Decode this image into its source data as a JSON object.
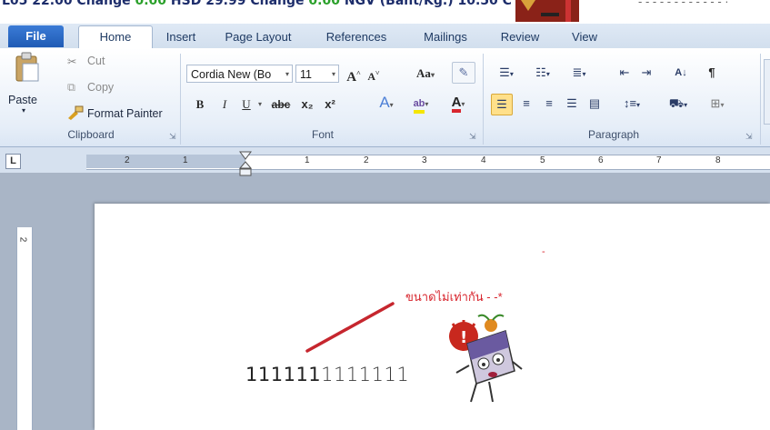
{
  "ticker": {
    "text1": "L05 22.00 Change ",
    "g1": "0.00",
    "text2": " HSD 29.99 Change ",
    "g2": "0.00",
    "text3": " NGV (Baht/Kg.) 10.50 C"
  },
  "tabs": [
    "File",
    "Home",
    "Insert",
    "Page Layout",
    "References",
    "Mailings",
    "Review",
    "View"
  ],
  "clipboard": {
    "paste": "Paste",
    "cut": "Cut",
    "copy": "Copy",
    "format_painter": "Format Painter",
    "label": "Clipboard"
  },
  "font": {
    "name": "Cordia New (Bo",
    "size": "11",
    "label": "Font",
    "bold": "B",
    "italic": "I",
    "underline": "U",
    "strike": "abc",
    "subscript": "x₂",
    "superscript": "x²",
    "grow": "A",
    "shrink": "A",
    "change_case": "Aa"
  },
  "paragraph": {
    "label": "Paragraph",
    "sort": "A↓",
    "pilcrow": "¶"
  },
  "ruler": {
    "ticks": [
      "2",
      "1",
      "1",
      "2",
      "3",
      "4",
      "5",
      "6",
      "7",
      "8"
    ],
    "tab_selector": "L"
  },
  "vruler": {
    "label": "2"
  },
  "document": {
    "annotation": "ขนาดไม่เท่ากัน  - -*",
    "dash": "-",
    "numbers_big": "111111",
    "numbers_small": "1111111"
  },
  "colors": {
    "accent": "#1f5bb5",
    "annotation": "#d8262e",
    "ribbon_bg": "#e6eef8"
  }
}
